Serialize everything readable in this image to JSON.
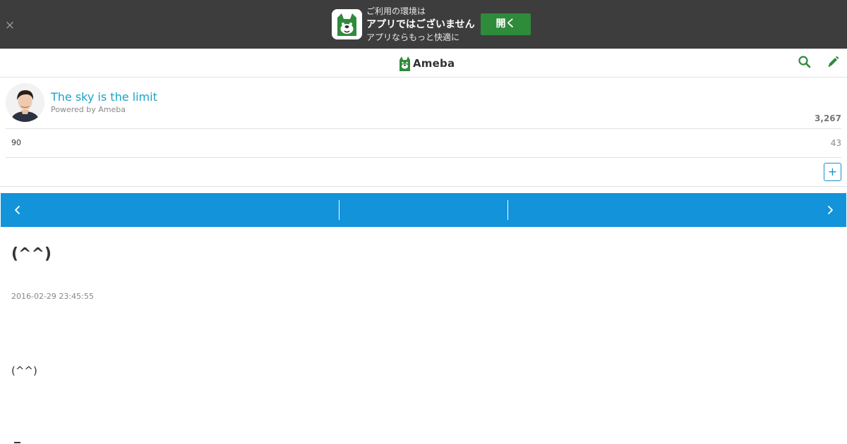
{
  "banner": {
    "line1": "ご利用の環境は",
    "line2": "アプリではございません",
    "line3": "アプリならもっと快適に",
    "open_label": "開く",
    "close_glyph": "×",
    "icon": "ameba-app-icon",
    "background": "#3d3d3d",
    "button_color": "#2e8b3a"
  },
  "header": {
    "logo_text": "Ameba",
    "logo_icon": "ameba-logo-icon",
    "search_icon": "search-icon",
    "edit_icon": "pencil-icon",
    "accent": "#2e8b3a"
  },
  "blog": {
    "title": "The sky is the limit",
    "powered_by": "Powered by Ameba",
    "reader_count": "3,267",
    "stat_left": "90",
    "stat_right": "43",
    "follow_glyph": "+",
    "title_color": "#1aa3c7"
  },
  "nav": {
    "background": "#1393d9",
    "prev_icon": "chevron-left-icon",
    "next_icon": "chevron-right-icon"
  },
  "entry": {
    "title": "(^^)",
    "date": "2016-02-29 23:45:55",
    "body": "(^^)"
  }
}
